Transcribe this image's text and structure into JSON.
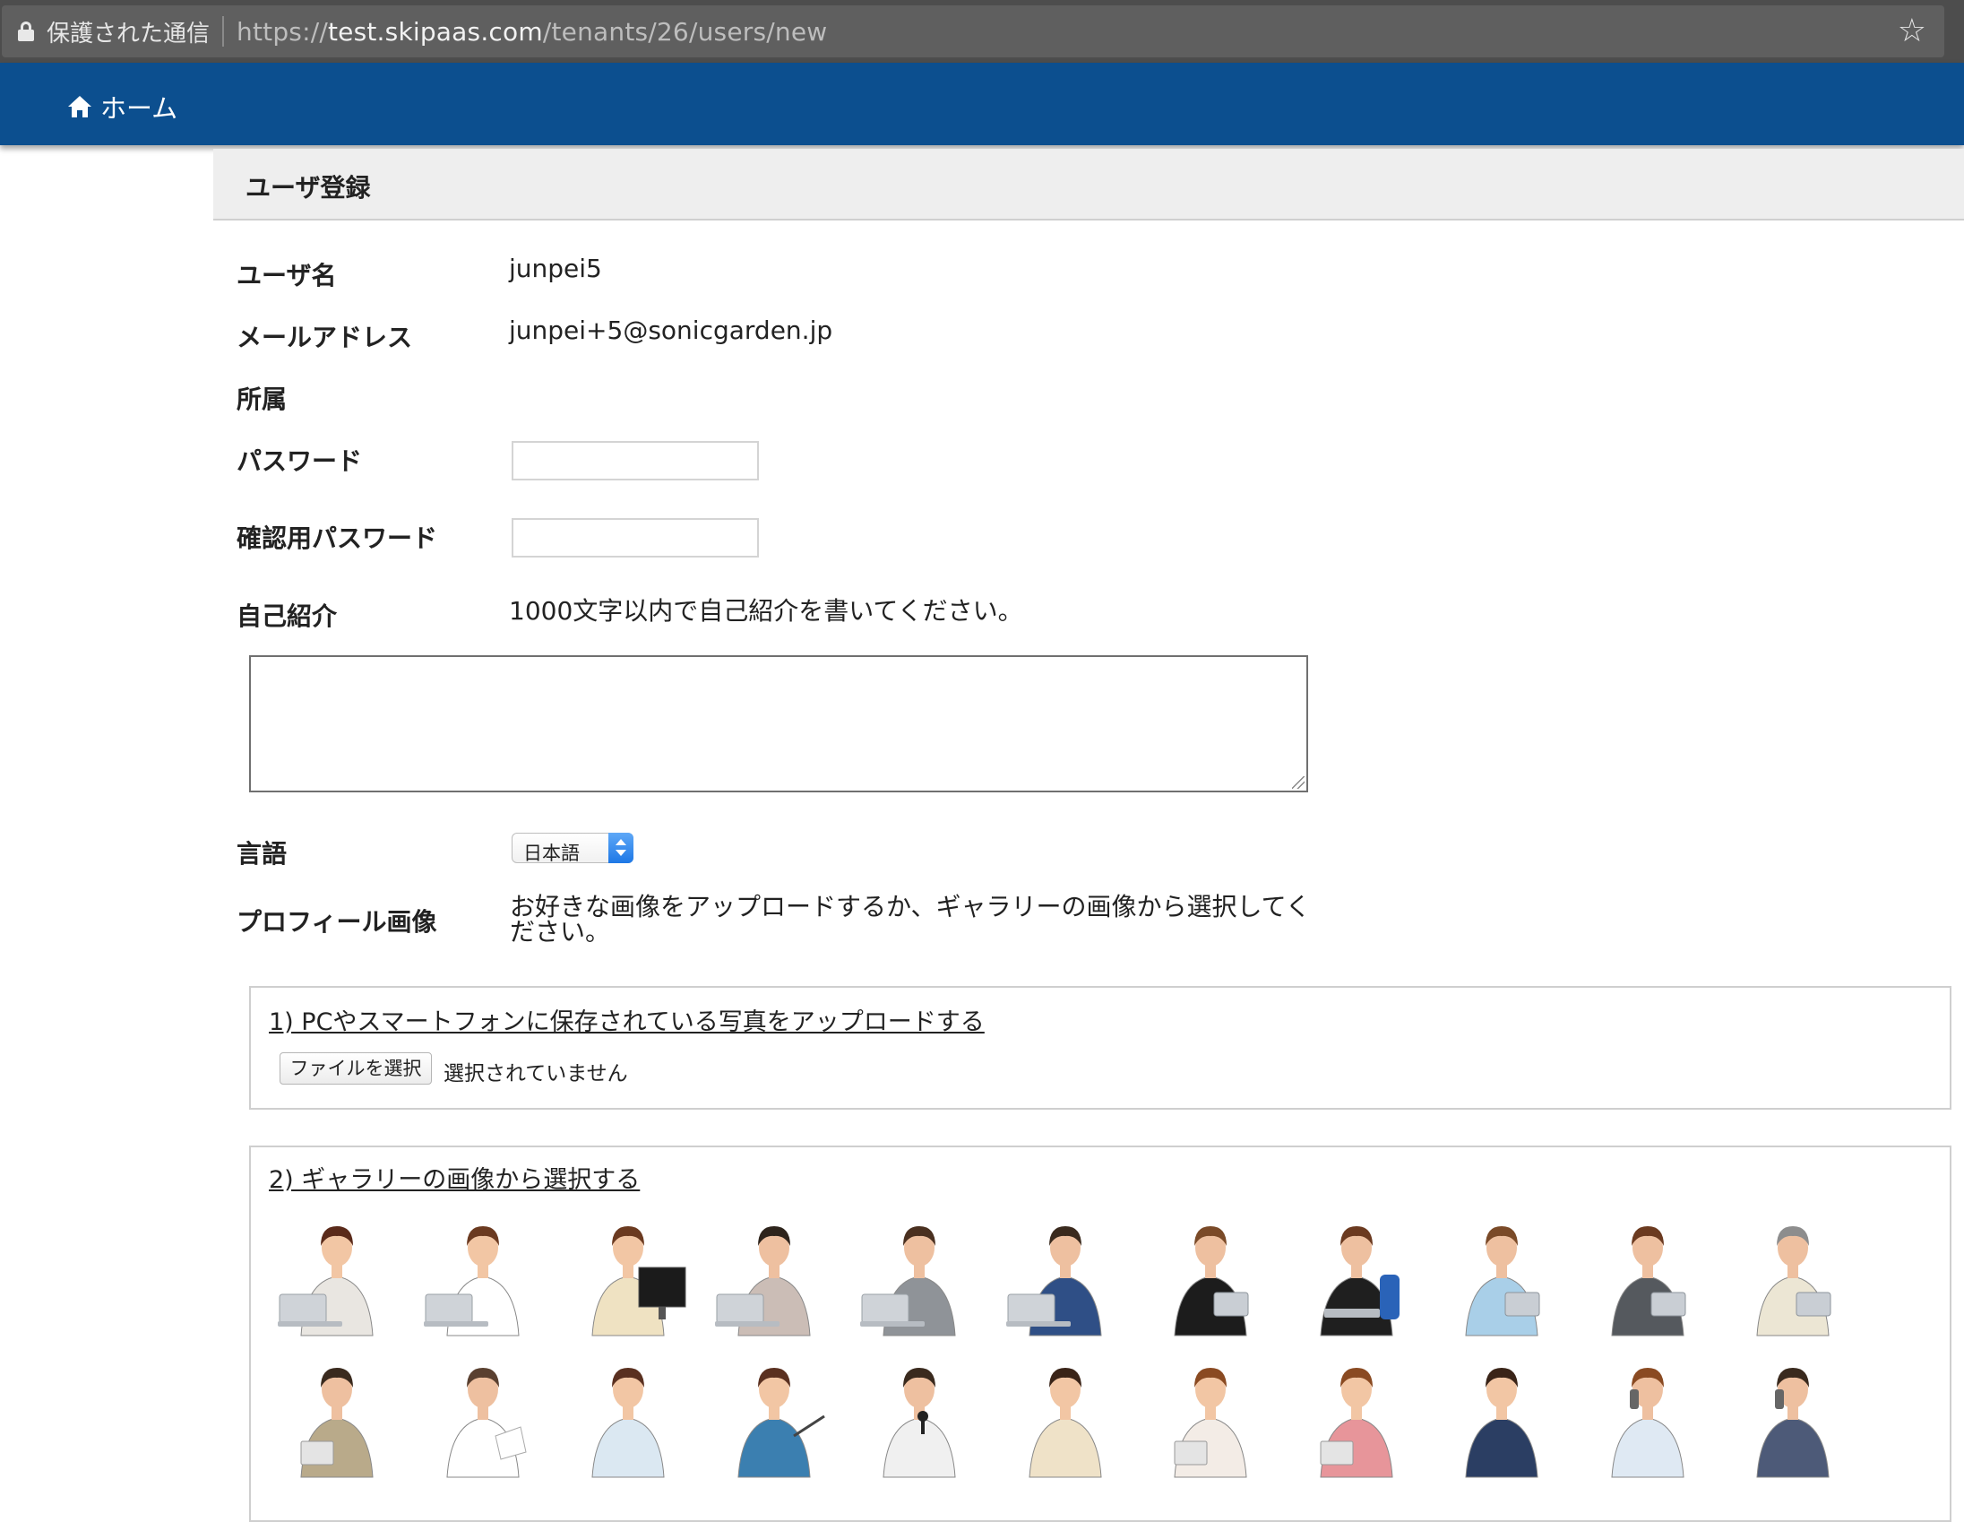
{
  "browser": {
    "secure_label": "保護された通信",
    "url_scheme": "https://",
    "url_host": "test.skipaas.com",
    "url_path": "/tenants/26/users/new",
    "bookmark_icon": "star-icon",
    "lock_icon": "lock-icon"
  },
  "nav": {
    "home_label": "ホーム",
    "home_icon": "home-icon",
    "bar_color": "#0c4f8f"
  },
  "page": {
    "title": "ユーザ登録"
  },
  "form": {
    "username_label": "ユーザ名",
    "username_value": "junpei5",
    "email_label": "メールアドレス",
    "email_value": "junpei+5@sonicgarden.jp",
    "affiliation_label": "所属",
    "password_label": "パスワード",
    "password_value": "",
    "password_confirm_label": "確認用パスワード",
    "password_confirm_value": "",
    "bio_label": "自己紹介",
    "bio_help": "1000文字以内で自己紹介を書いてください。",
    "bio_value": "",
    "language_label": "言語",
    "language_selected": "日本語",
    "profile_image_label": "プロフィール画像",
    "profile_image_help": "お好きな画像をアップロードするか、ギャラリーの画像から選択してください。"
  },
  "upload": {
    "title": "1) PCやスマートフォンに保存されている写真をアップロードする",
    "file_button": "ファイルを選択",
    "file_status": "選択されていません"
  },
  "gallery": {
    "title": "2) ギャラリーの画像から選択する",
    "rows": [
      [
        {
          "name": "woman-laptop-avatar",
          "skin": "#f2c6a4",
          "hair": "#5a2a1a",
          "top": "#e9e6e1",
          "prop": "laptop"
        },
        {
          "name": "woman-laptop-dark-skirt-avatar",
          "skin": "#f2c6a4",
          "hair": "#6b3a20",
          "top": "#ffffff",
          "prop": "laptop"
        },
        {
          "name": "woman-monitor-avatar",
          "skin": "#f2c6a4",
          "hair": "#6b3a20",
          "top": "#efe2c2",
          "prop": "monitor"
        },
        {
          "name": "man-desk-laptop-avatar",
          "skin": "#eec0a0",
          "hair": "#2e241c",
          "top": "#cbbdb6",
          "prop": "laptop"
        },
        {
          "name": "man-vest-laptop-avatar",
          "skin": "#eec0a0",
          "hair": "#4a3020",
          "top": "#8f9398",
          "prop": "laptop"
        },
        {
          "name": "man-blue-suit-laptop-avatar",
          "skin": "#eec0a0",
          "hair": "#3a2a1e",
          "top": "#2f4f86",
          "prop": "laptop"
        },
        {
          "name": "man-black-suit-tablet-avatar",
          "skin": "#eec0a0",
          "hair": "#7a4a28",
          "top": "#1c1c1c",
          "prop": "tablet"
        },
        {
          "name": "man-chair-laptop-avatar",
          "skin": "#eec0a0",
          "hair": "#6b3a20",
          "top": "#1f1f1f",
          "prop": "chair"
        },
        {
          "name": "man-light-blue-shirt-avatar",
          "skin": "#eec0a0",
          "hair": "#7a4a28",
          "top": "#a9cfe8",
          "prop": "tablet"
        },
        {
          "name": "man-gray-suit-tablet-avatar",
          "skin": "#eec0a0",
          "hair": "#6b3a20",
          "top": "#55595e",
          "prop": "tablet"
        },
        {
          "name": "senior-man-cream-suit-avatar",
          "skin": "#eec0a0",
          "hair": "#8d8d8d",
          "top": "#ece6d4",
          "prop": "tablet"
        }
      ],
      [
        {
          "name": "man-khaki-shirt-folder-avatar",
          "skin": "#eec0a0",
          "hair": "#3a2a1e",
          "top": "#b9aa8a",
          "prop": "folder"
        },
        {
          "name": "man-white-shirt-pointing-avatar",
          "skin": "#eec0a0",
          "hair": "#5a4030",
          "top": "#ffffff",
          "prop": "paper"
        },
        {
          "name": "woman-presenting-avatar",
          "skin": "#f2c6a4",
          "hair": "#5a3020",
          "top": "#dbe8f2",
          "prop": "none"
        },
        {
          "name": "woman-blue-sweater-pointer-avatar",
          "skin": "#f2c6a4",
          "hair": "#5a3020",
          "top": "#3b7fb0",
          "prop": "pointer"
        },
        {
          "name": "man-microphone-avatar",
          "skin": "#eec0a0",
          "hair": "#3a2a1e",
          "top": "#f0f0f0",
          "prop": "mic"
        },
        {
          "name": "woman-beige-jacket-avatar",
          "skin": "#f2c6a4",
          "hair": "#3a2418",
          "top": "#efe2c8",
          "prop": "none"
        },
        {
          "name": "woman-phone-folder-avatar",
          "skin": "#f2c6a4",
          "hair": "#8a4a22",
          "top": "#f3ece6",
          "prop": "folder"
        },
        {
          "name": "woman-pink-shirt-phone-avatar",
          "skin": "#f2c6a4",
          "hair": "#8a4a22",
          "top": "#e7959a",
          "prop": "folder"
        },
        {
          "name": "woman-navy-jacket-phone-avatar",
          "skin": "#f2c6a4",
          "hair": "#3a2418",
          "top": "#2b3e63",
          "prop": "none"
        },
        {
          "name": "man-phone-call-avatar",
          "skin": "#eec0a0",
          "hair": "#8a4a22",
          "top": "#dfe9f3",
          "prop": "phone"
        },
        {
          "name": "man-navy-suit-phone-avatar",
          "skin": "#eec0a0",
          "hair": "#3a2a1e",
          "top": "#4d5a78",
          "prop": "phone"
        }
      ]
    ]
  }
}
